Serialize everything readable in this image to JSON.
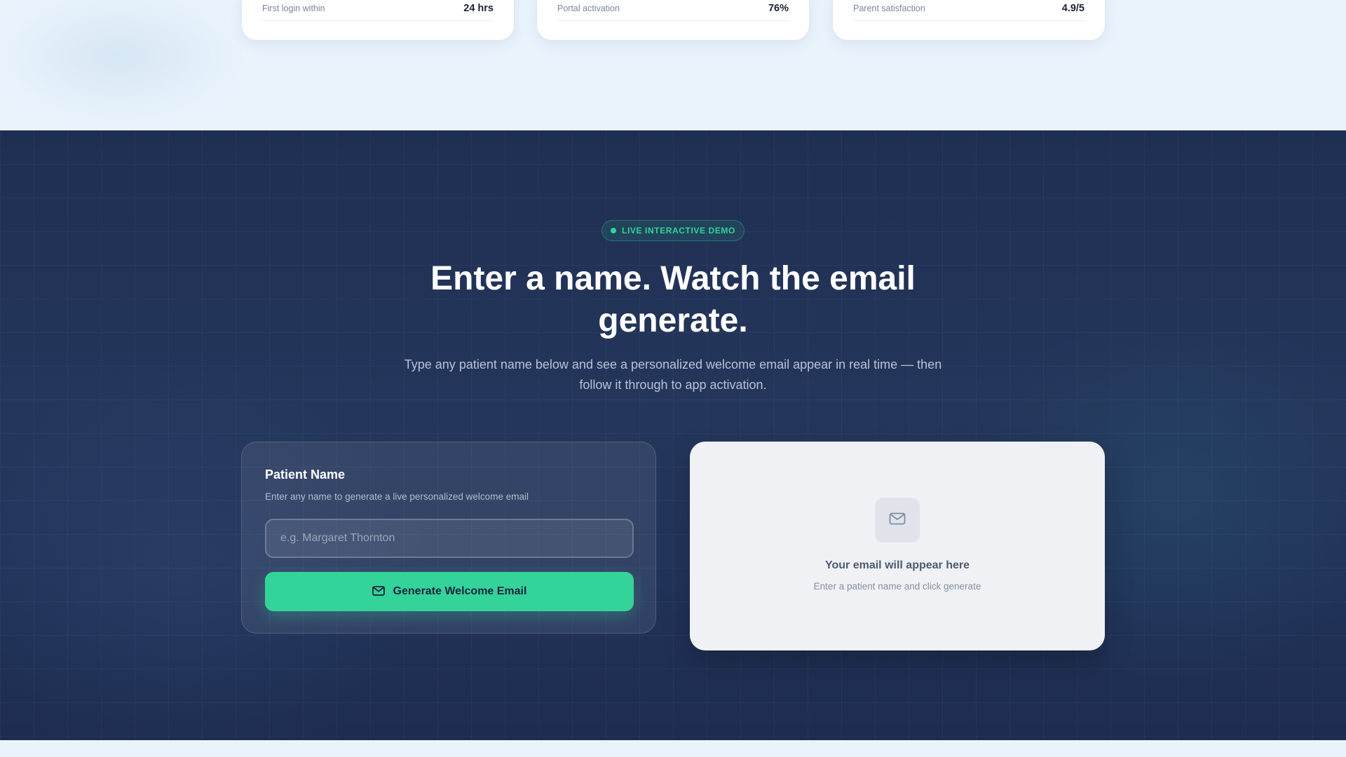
{
  "stats": [
    {
      "label": "First login within",
      "value": "24 hrs"
    },
    {
      "label": "Portal activation",
      "value": "76%"
    },
    {
      "label": "Parent satisfaction",
      "value": "4.9/5"
    }
  ],
  "demo": {
    "badge": "LIVE INTERACTIVE DEMO",
    "headline": "Enter a name. Watch the email generate.",
    "subtext": "Type any patient name below and see a personalized welcome email appear in real time — then follow it through to app activation."
  },
  "form": {
    "title": "Patient Name",
    "help": "Enter any name to generate a live personalized welcome email",
    "input_value": "",
    "input_placeholder": "e.g. Margaret Thornton",
    "button_label": "Generate Welcome Email",
    "button_icon": "mail-icon"
  },
  "preview": {
    "icon": "mail-icon",
    "title": "Your email will appear here",
    "subtitle": "Enter a patient name and click generate"
  },
  "colors": {
    "accent": "#34d399",
    "dark_bg": "#22345a",
    "light_bg": "#e9f3fc"
  }
}
